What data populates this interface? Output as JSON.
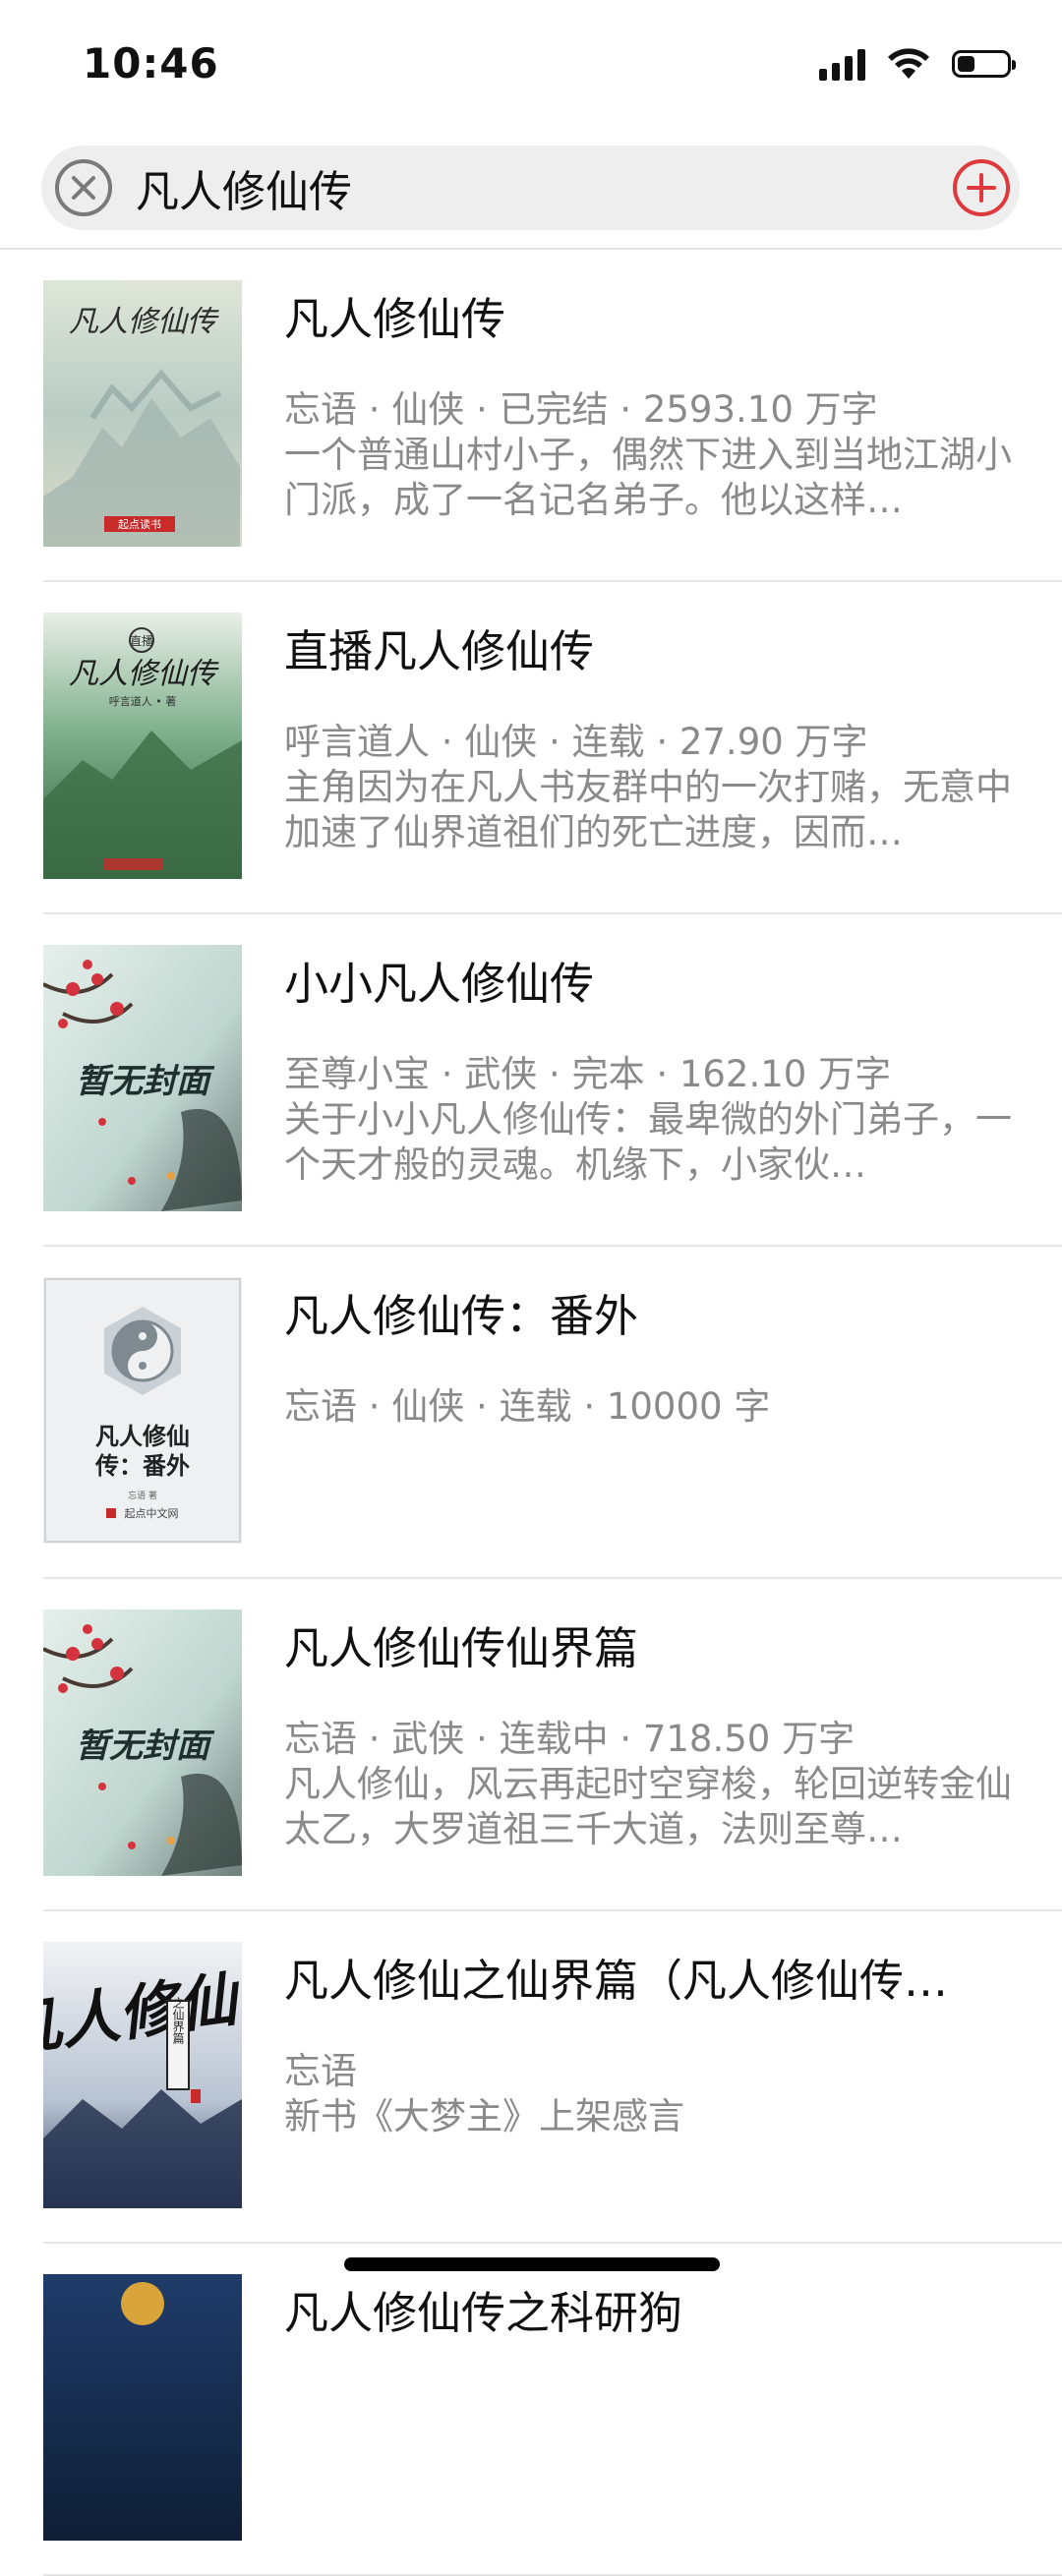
{
  "status_bar": {
    "time": "10:46",
    "battery_level": 0.35
  },
  "search": {
    "value": "凡人修仙传"
  },
  "results": [
    {
      "title": "凡人修仙传",
      "meta": "忘语 · 仙侠 · 已完结 · 2593.10 万字",
      "description": "一个普通山村小子，偶然下进入到当地江湖小门派，成了一名记名弟子。他以这样…",
      "cover_text": "凡人修仙传",
      "cover_publisher": "起点读书"
    },
    {
      "title": "直播凡人修仙传",
      "meta": "呼言道人 · 仙侠 · 连载 · 27.90 万字",
      "description": "主角因为在凡人书友群中的一次打赌，无意中加速了仙界道祖们的死亡进度，因而…",
      "cover_badge": "直播",
      "cover_text": "凡人修仙传",
      "cover_author": "呼言道人 • 著"
    },
    {
      "title": "小小凡人修仙传",
      "meta": "至尊小宝 · 武侠 · 完本 · 162.10 万字",
      "description": "关于小小凡人修仙传：最卑微的外门弟子，一个天才般的灵魂。机缘下，小家伙…",
      "cover_text": "暂无封面"
    },
    {
      "title": "凡人修仙传：番外",
      "meta": "忘语 · 仙侠 · 连载 · 10000 字",
      "description": "",
      "cover_text_line1": "凡人修仙",
      "cover_text_line2": "传：番外",
      "cover_author": "忘语 著",
      "cover_publisher": "起点中文网"
    },
    {
      "title": "凡人修仙传仙界篇",
      "meta": "忘语 · 武侠 · 连载中 · 718.50 万字",
      "description": "凡人修仙，风云再起时空穿梭，轮回逆转金仙太乙，大罗道祖三千大道，法则至尊…",
      "cover_text": "暂无封面"
    },
    {
      "title": "凡人修仙之仙界篇（凡人修仙传…",
      "meta": "忘语",
      "description": "新书《大梦主》上架感言",
      "cover_text": "凡人修仙",
      "cover_subtitle": "之仙界篇"
    },
    {
      "title": "凡人修仙传之科研狗",
      "meta": "",
      "description": ""
    }
  ]
}
